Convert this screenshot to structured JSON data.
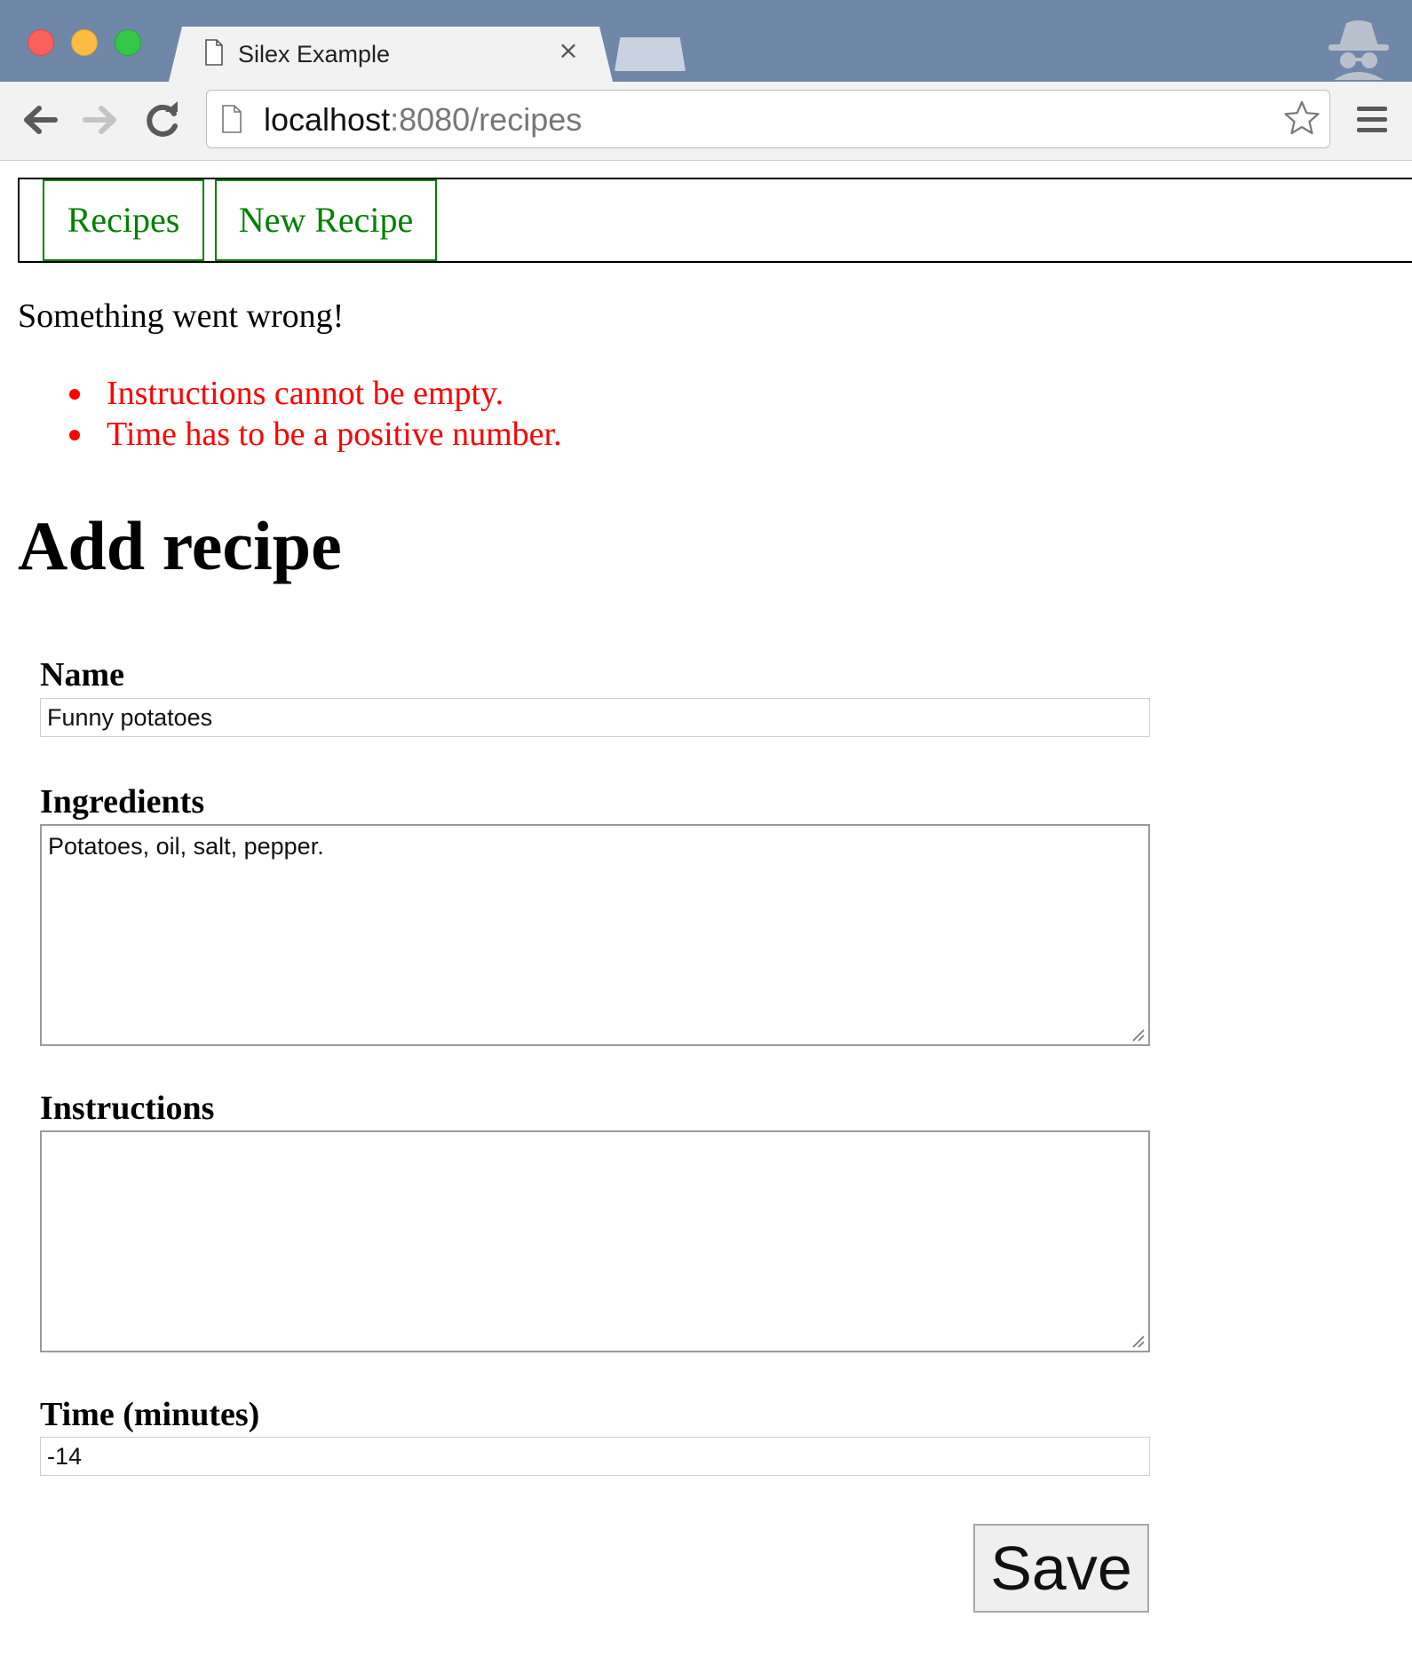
{
  "browser": {
    "tab_title": "Silex Example",
    "tab_close": "×",
    "url_host": "localhost",
    "url_path": ":8080/recipes",
    "icons": [
      "page-icon",
      "close-icon",
      "incognito-icon",
      "back-arrow-icon",
      "forward-arrow-icon",
      "reload-icon",
      "star-icon",
      "menu-icon",
      "resize-grip-icon"
    ]
  },
  "nav": {
    "items": [
      {
        "label": "Recipes"
      },
      {
        "label": "New Recipe"
      }
    ],
    "border_color": "#008000"
  },
  "errors": {
    "heading": "Something went wrong!",
    "items": [
      "Instructions cannot be empty.",
      "Time has to be a positive number."
    ],
    "color": "#ff0000"
  },
  "form": {
    "title": "Add recipe",
    "name_label": "Name",
    "name_value": "Funny potatoes",
    "ingredients_label": "Ingredients",
    "ingredients_value": "Potatoes, oil, salt, pepper.",
    "instructions_label": "Instructions",
    "instructions_value": "",
    "time_label": "Time (minutes)",
    "time_value": "-14",
    "save_label": "Save"
  }
}
